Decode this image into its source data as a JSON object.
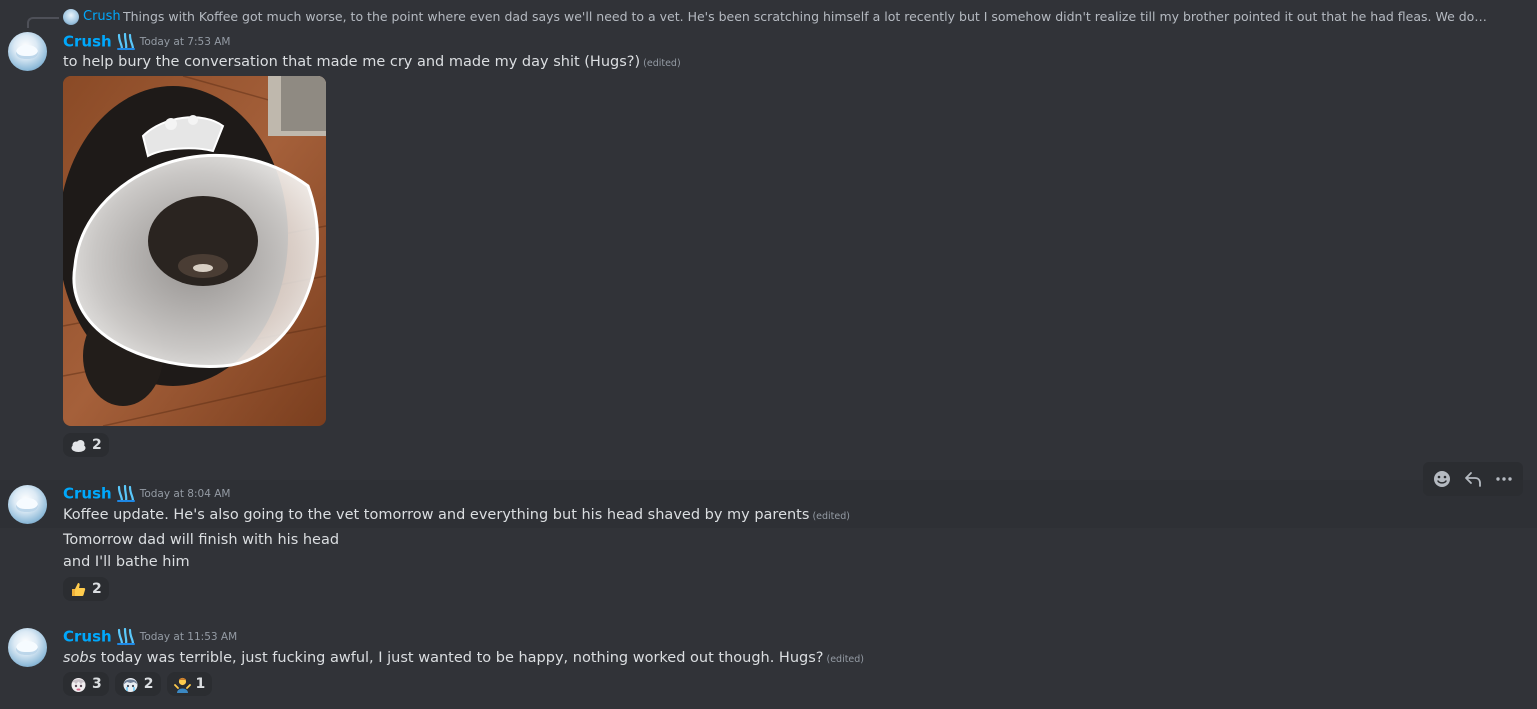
{
  "reply": {
    "author": "Crush",
    "text": "Things with Koffee got much worse, to the point where even dad says we'll need to a vet. He's been scratching himself a lot recently but I somehow didn't realize till my brother pointed it out that he had fleas. We don't have flea sha..."
  },
  "messages": [
    {
      "author": "Crush",
      "timestamp": "Today at 7:53 AM",
      "lines": [
        "to help bury the conversation that made me cry and made my day shit (Hugs?)"
      ],
      "edited": "(edited)",
      "reactions": [
        {
          "emoji": "cloud",
          "count": "2"
        }
      ]
    },
    {
      "author": "Crush",
      "timestamp": "Today at 8:04 AM",
      "lines": [
        "Koffee update. He's also going to the vet tomorrow and everything but his head shaved by my parents",
        "Tomorrow dad will finish with his head",
        "and I'll bathe him"
      ],
      "edited": "(edited)",
      "reactions": [
        {
          "emoji": "thumbs-up",
          "count": "2"
        }
      ]
    },
    {
      "author": "Crush",
      "timestamp": "Today at 11:53 AM",
      "emphasis": "sobs",
      "lines": [
        " today was terrible, just fucking awful, I just wanted to be happy, nothing worked out though. Hugs?"
      ],
      "edited": "(edited)",
      "reactions": [
        {
          "emoji": "sad-character",
          "count": "3"
        },
        {
          "emoji": "crying-character",
          "count": "2"
        },
        {
          "emoji": "person-shrug",
          "count": "1"
        }
      ]
    }
  ],
  "toolbar": {
    "icons": [
      "add-reaction-icon",
      "reply-icon",
      "more-options-icon"
    ]
  },
  "colors": {
    "background": "#313338",
    "author": "#00a8fc",
    "text": "#dbdee1",
    "muted": "#949ba4"
  }
}
